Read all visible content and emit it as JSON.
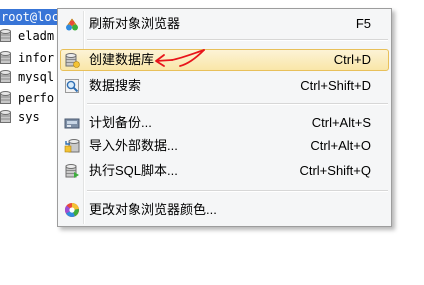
{
  "tree": {
    "root_label": "root@loc",
    "databases": [
      "eladm",
      "infor",
      "mysql",
      "perfo",
      "sys"
    ]
  },
  "menu": {
    "items": [
      {
        "label": "刷新对象浏览器",
        "shortcut": "F5",
        "icon": "refresh-icon"
      },
      {
        "label": "创建数据库",
        "shortcut": "Ctrl+D",
        "icon": "create-database-icon",
        "highlighted": true
      },
      {
        "label": "数据搜索",
        "shortcut": "Ctrl+Shift+D",
        "icon": "data-search-icon"
      },
      {
        "label": "计划备份...",
        "shortcut": "Ctrl+Alt+S",
        "icon": "scheduled-backup-icon"
      },
      {
        "label": "导入外部数据...",
        "shortcut": "Ctrl+Alt+O",
        "icon": "import-data-icon"
      },
      {
        "label": "执行SQL脚本...",
        "shortcut": "Ctrl+Shift+Q",
        "icon": "execute-sql-script-icon"
      },
      {
        "label": "更改对象浏览器颜色...",
        "shortcut": "",
        "icon": "color-wheel-icon"
      }
    ]
  },
  "colors": {
    "selection_blue": "#3875d7",
    "highlight_border": "#e8c05a",
    "annotation_red": "#e8141b"
  }
}
